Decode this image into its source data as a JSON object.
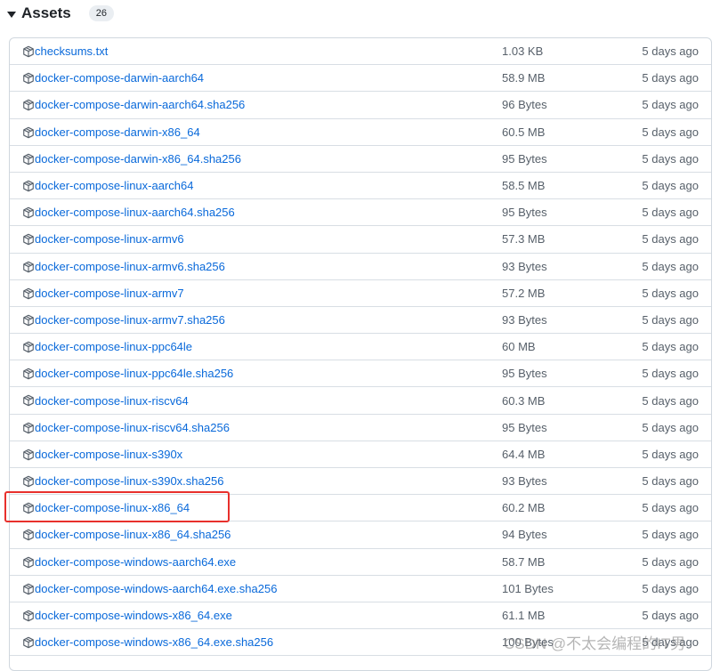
{
  "header": {
    "title": "Assets",
    "count": "26"
  },
  "assets": [
    {
      "name": "checksums.txt",
      "size": "1.03 KB",
      "date": "5 days ago"
    },
    {
      "name": "docker-compose-darwin-aarch64",
      "size": "58.9 MB",
      "date": "5 days ago"
    },
    {
      "name": "docker-compose-darwin-aarch64.sha256",
      "size": "96 Bytes",
      "date": "5 days ago"
    },
    {
      "name": "docker-compose-darwin-x86_64",
      "size": "60.5 MB",
      "date": "5 days ago"
    },
    {
      "name": "docker-compose-darwin-x86_64.sha256",
      "size": "95 Bytes",
      "date": "5 days ago"
    },
    {
      "name": "docker-compose-linux-aarch64",
      "size": "58.5 MB",
      "date": "5 days ago"
    },
    {
      "name": "docker-compose-linux-aarch64.sha256",
      "size": "95 Bytes",
      "date": "5 days ago"
    },
    {
      "name": "docker-compose-linux-armv6",
      "size": "57.3 MB",
      "date": "5 days ago"
    },
    {
      "name": "docker-compose-linux-armv6.sha256",
      "size": "93 Bytes",
      "date": "5 days ago"
    },
    {
      "name": "docker-compose-linux-armv7",
      "size": "57.2 MB",
      "date": "5 days ago"
    },
    {
      "name": "docker-compose-linux-armv7.sha256",
      "size": "93 Bytes",
      "date": "5 days ago"
    },
    {
      "name": "docker-compose-linux-ppc64le",
      "size": "60 MB",
      "date": "5 days ago"
    },
    {
      "name": "docker-compose-linux-ppc64le.sha256",
      "size": "95 Bytes",
      "date": "5 days ago"
    },
    {
      "name": "docker-compose-linux-riscv64",
      "size": "60.3 MB",
      "date": "5 days ago"
    },
    {
      "name": "docker-compose-linux-riscv64.sha256",
      "size": "95 Bytes",
      "date": "5 days ago"
    },
    {
      "name": "docker-compose-linux-s390x",
      "size": "64.4 MB",
      "date": "5 days ago"
    },
    {
      "name": "docker-compose-linux-s390x.sha256",
      "size": "93 Bytes",
      "date": "5 days ago"
    },
    {
      "name": "docker-compose-linux-x86_64",
      "size": "60.2 MB",
      "date": "5 days ago"
    },
    {
      "name": "docker-compose-linux-x86_64.sha256",
      "size": "94 Bytes",
      "date": "5 days ago"
    },
    {
      "name": "docker-compose-windows-aarch64.exe",
      "size": "58.7 MB",
      "date": "5 days ago"
    },
    {
      "name": "docker-compose-windows-aarch64.exe.sha256",
      "size": "101 Bytes",
      "date": "5 days ago"
    },
    {
      "name": "docker-compose-windows-x86_64.exe",
      "size": "61.1 MB",
      "date": "5 days ago"
    },
    {
      "name": "docker-compose-windows-x86_64.exe.sha256",
      "size": "100 Bytes",
      "date": "5 days ago"
    }
  ],
  "icon": "package-icon",
  "colors": {
    "link": "#0969da",
    "muted": "#57606a",
    "highlight": "#e8302c"
  },
  "watermark": "CSDN @不太会编程的IT男"
}
